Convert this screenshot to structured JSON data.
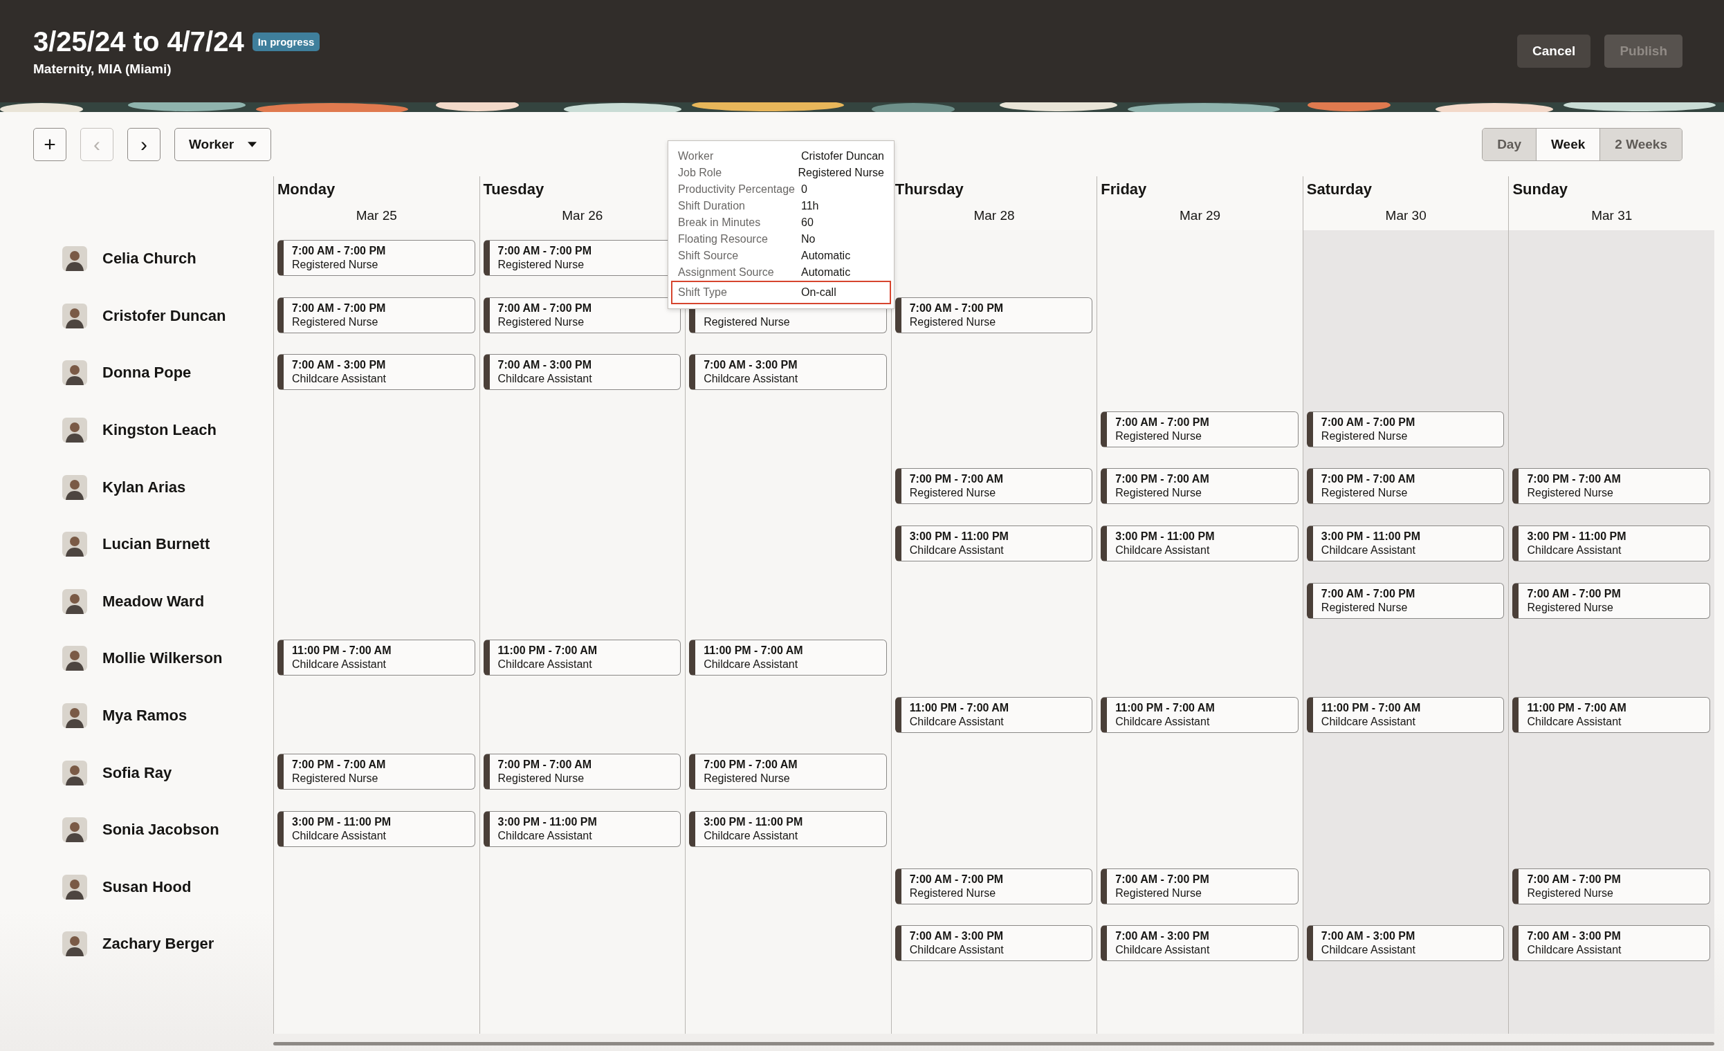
{
  "header": {
    "title": "3/25/24 to 4/7/24",
    "status": "In progress",
    "subtitle": "Maternity, MIA (Miami)",
    "buttons": [
      {
        "label": "Cancel",
        "disabled": false
      },
      {
        "label": "Publish",
        "disabled": true
      }
    ]
  },
  "toolbar": {
    "add": "+",
    "prev": {
      "label": "‹",
      "disabled": true
    },
    "next": {
      "label": "›",
      "disabled": false
    },
    "group_by": "Worker",
    "views": [
      {
        "label": "Day",
        "selected": false
      },
      {
        "label": "Week",
        "selected": true
      },
      {
        "label": "2 Weeks",
        "selected": false
      }
    ]
  },
  "days": [
    {
      "name": "Monday",
      "date": "Mar 25",
      "weekend": false
    },
    {
      "name": "Tuesday",
      "date": "Mar 26",
      "weekend": false
    },
    {
      "weekend": false
    },
    {
      "name": "Thursday",
      "date": "Mar 28",
      "weekend": false
    },
    {
      "name": "Friday",
      "date": "Mar 29",
      "weekend": false
    },
    {
      "name": "Saturday",
      "date": "Mar 30",
      "weekend": true
    },
    {
      "name": "Sunday",
      "date": "Mar 31",
      "weekend": true
    }
  ],
  "workers": [
    {
      "name": "Celia Church",
      "shifts": [
        {
          "kind": "shift",
          "time": "7:00 AM - 7:00 PM",
          "role": "Registered Nurse"
        },
        {
          "kind": "shift",
          "time": "7:00 AM - 7:00 PM",
          "role": "Registered Nurse"
        },
        {
          "kind": "empty"
        },
        {
          "kind": "empty"
        },
        {
          "kind": "empty"
        },
        {
          "kind": "empty"
        },
        {
          "kind": "empty"
        }
      ]
    },
    {
      "name": "Cristofer Duncan",
      "shifts": [
        {
          "kind": "shift",
          "time": "7:00 AM - 7:00 PM",
          "role": "Registered Nurse"
        },
        {
          "kind": "shift",
          "time": "7:00 AM - 7:00 PM",
          "role": "Registered Nurse"
        },
        {
          "kind": "shift",
          "role": "Registered Nurse"
        },
        {
          "kind": "shift",
          "time": "7:00 AM - 7:00 PM",
          "role": "Registered Nurse"
        },
        {
          "kind": "empty"
        },
        {
          "kind": "empty"
        },
        {
          "kind": "empty"
        }
      ]
    },
    {
      "name": "Donna Pope",
      "shifts": [
        {
          "kind": "shift",
          "time": "7:00 AM - 3:00 PM",
          "role": "Childcare Assistant"
        },
        {
          "kind": "shift",
          "time": "7:00 AM - 3:00 PM",
          "role": "Childcare Assistant"
        },
        {
          "kind": "shift",
          "time": "7:00 AM - 3:00 PM",
          "role": "Childcare Assistant"
        },
        {
          "kind": "empty"
        },
        {
          "kind": "empty"
        },
        {
          "kind": "empty"
        },
        {
          "kind": "empty"
        }
      ]
    },
    {
      "name": "Kingston Leach",
      "shifts": [
        {
          "kind": "empty"
        },
        {
          "kind": "empty"
        },
        {
          "kind": "empty"
        },
        {
          "kind": "empty"
        },
        {
          "kind": "shift",
          "time": "7:00 AM - 7:00 PM",
          "role": "Registered Nurse"
        },
        {
          "kind": "shift",
          "time": "7:00 AM - 7:00 PM",
          "role": "Registered Nurse"
        },
        {
          "kind": "empty"
        }
      ]
    },
    {
      "name": "Kylan Arias",
      "shifts": [
        {
          "kind": "empty"
        },
        {
          "kind": "empty"
        },
        {
          "kind": "empty"
        },
        {
          "kind": "shift",
          "time": "7:00 PM - 7:00 AM",
          "role": "Registered Nurse"
        },
        {
          "kind": "shift",
          "time": "7:00 PM - 7:00 AM",
          "role": "Registered Nurse"
        },
        {
          "kind": "shift",
          "time": "7:00 PM - 7:00 AM",
          "role": "Registered Nurse"
        },
        {
          "kind": "shift",
          "time": "7:00 PM - 7:00 AM",
          "role": "Registered Nurse"
        }
      ]
    },
    {
      "name": "Lucian Burnett",
      "shifts": [
        {
          "kind": "empty"
        },
        {
          "kind": "empty"
        },
        {
          "kind": "empty"
        },
        {
          "kind": "shift",
          "time": "3:00 PM - 11:00 PM",
          "role": "Childcare Assistant"
        },
        {
          "kind": "shift",
          "time": "3:00 PM - 11:00 PM",
          "role": "Childcare Assistant"
        },
        {
          "kind": "shift",
          "time": "3:00 PM - 11:00 PM",
          "role": "Childcare Assistant"
        },
        {
          "kind": "shift",
          "time": "3:00 PM - 11:00 PM",
          "role": "Childcare Assistant"
        }
      ]
    },
    {
      "name": "Meadow Ward",
      "shifts": [
        {
          "kind": "empty"
        },
        {
          "kind": "empty"
        },
        {
          "kind": "empty"
        },
        {
          "kind": "empty"
        },
        {
          "kind": "empty"
        },
        {
          "kind": "shift",
          "time": "7:00 AM - 7:00 PM",
          "role": "Registered Nurse"
        },
        {
          "kind": "shift",
          "time": "7:00 AM - 7:00 PM",
          "role": "Registered Nurse"
        }
      ]
    },
    {
      "name": "Mollie Wilkerson",
      "shifts": [
        {
          "kind": "shift",
          "time": "11:00 PM - 7:00 AM",
          "role": "Childcare Assistant"
        },
        {
          "kind": "shift",
          "time": "11:00 PM - 7:00 AM",
          "role": "Childcare Assistant"
        },
        {
          "kind": "shift",
          "time": "11:00 PM - 7:00 AM",
          "role": "Childcare Assistant"
        },
        {
          "kind": "empty"
        },
        {
          "kind": "empty"
        },
        {
          "kind": "empty"
        },
        {
          "kind": "empty"
        }
      ]
    },
    {
      "name": "Mya Ramos",
      "shifts": [
        {
          "kind": "empty"
        },
        {
          "kind": "empty"
        },
        {
          "kind": "empty"
        },
        {
          "kind": "shift",
          "time": "11:00 PM - 7:00 AM",
          "role": "Childcare Assistant"
        },
        {
          "kind": "shift",
          "time": "11:00 PM - 7:00 AM",
          "role": "Childcare Assistant"
        },
        {
          "kind": "shift",
          "time": "11:00 PM - 7:00 AM",
          "role": "Childcare Assistant"
        },
        {
          "kind": "shift",
          "time": "11:00 PM - 7:00 AM",
          "role": "Childcare Assistant"
        }
      ]
    },
    {
      "name": "Sofia Ray",
      "shifts": [
        {
          "kind": "shift",
          "time": "7:00 PM - 7:00 AM",
          "role": "Registered Nurse"
        },
        {
          "kind": "shift",
          "time": "7:00 PM - 7:00 AM",
          "role": "Registered Nurse"
        },
        {
          "kind": "shift",
          "time": "7:00 PM - 7:00 AM",
          "role": "Registered Nurse"
        },
        {
          "kind": "empty"
        },
        {
          "kind": "empty"
        },
        {
          "kind": "empty"
        },
        {
          "kind": "empty"
        }
      ]
    },
    {
      "name": "Sonia Jacobson",
      "shifts": [
        {
          "kind": "shift",
          "time": "3:00 PM - 11:00 PM",
          "role": "Childcare Assistant"
        },
        {
          "kind": "shift",
          "time": "3:00 PM - 11:00 PM",
          "role": "Childcare Assistant"
        },
        {
          "kind": "shift",
          "time": "3:00 PM - 11:00 PM",
          "role": "Childcare Assistant"
        },
        {
          "kind": "empty"
        },
        {
          "kind": "empty"
        },
        {
          "kind": "empty"
        },
        {
          "kind": "empty"
        }
      ]
    },
    {
      "name": "Susan Hood",
      "shifts": [
        {
          "kind": "empty"
        },
        {
          "kind": "empty"
        },
        {
          "kind": "empty"
        },
        {
          "kind": "shift",
          "time": "7:00 AM - 7:00 PM",
          "role": "Registered Nurse"
        },
        {
          "kind": "shift",
          "time": "7:00 AM - 7:00 PM",
          "role": "Registered Nurse"
        },
        {
          "kind": "empty"
        },
        {
          "kind": "shift",
          "time": "7:00 AM - 7:00 PM",
          "role": "Registered Nurse"
        }
      ]
    },
    {
      "name": "Zachary Berger",
      "shifts": [
        {
          "kind": "empty"
        },
        {
          "kind": "empty"
        },
        {
          "kind": "empty"
        },
        {
          "kind": "shift",
          "time": "7:00 AM - 3:00 PM",
          "role": "Childcare Assistant"
        },
        {
          "kind": "shift",
          "time": "7:00 AM - 3:00 PM",
          "role": "Childcare Assistant"
        },
        {
          "kind": "shift",
          "time": "7:00 AM - 3:00 PM",
          "role": "Childcare Assistant"
        },
        {
          "kind": "shift",
          "time": "7:00 AM - 3:00 PM",
          "role": "Childcare Assistant"
        }
      ]
    }
  ],
  "tooltip": {
    "rows": [
      {
        "label": "Worker",
        "value": "Cristofer Duncan",
        "highlighted": false
      },
      {
        "label": "Job Role",
        "value": "Registered Nurse",
        "highlighted": false
      },
      {
        "label": "Productivity Percentage",
        "value": "0",
        "highlighted": false
      },
      {
        "label": "Shift Duration",
        "value": "11h",
        "highlighted": false
      },
      {
        "label": "Break in Minutes",
        "value": "60",
        "highlighted": false
      },
      {
        "label": "Floating Resource",
        "value": "No",
        "highlighted": false
      },
      {
        "label": "Shift Source",
        "value": "Automatic",
        "highlighted": false
      },
      {
        "label": "Assignment Source",
        "value": "Automatic",
        "highlighted": false
      },
      {
        "label": "Shift Type",
        "value": "On-call",
        "highlighted": true
      }
    ]
  }
}
